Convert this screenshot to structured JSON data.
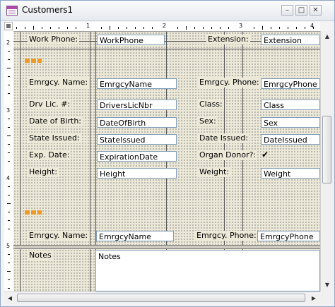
{
  "window": {
    "title": "Customers1",
    "controls": {
      "minimize": "–",
      "maximize": "□",
      "close": "✕"
    }
  },
  "icons": {
    "app": "form-icon",
    "scroll_up": "arrow-up-icon",
    "scroll_down": "arrow-down-icon",
    "scroll_left": "arrow-left-icon",
    "scroll_right": "arrow-right-icon"
  },
  "ruler": {
    "horizontal": [
      "1",
      "2",
      "3",
      "4"
    ],
    "vertical": [
      "2",
      "3",
      "4",
      "5"
    ]
  },
  "form": {
    "work_phone_label": "Work Phone:",
    "work_phone_field": "WorkPhone",
    "extension_label": "Extension:",
    "extension_field": "Extension",
    "emrgcy_name_label": "Emrgcy. Name:",
    "emrgcy_name_field": "EmrgcyName",
    "emrgcy_phone_label": "Emrgcy. Phone:",
    "emrgcy_phone_field": "EmrgcyPhone",
    "drv_lic_label": "Drv Lic. #:",
    "drv_lic_field": "DriversLicNbr",
    "class_label": "Class:",
    "class_field": "Class",
    "dob_label": "Date of Birth:",
    "dob_field": "DateOfBirth",
    "sex_label": "Sex:",
    "sex_field": "Sex",
    "state_issued_label": "State Issued:",
    "state_issued_field": "StateIssued",
    "date_issued_label": "Date Issued:",
    "date_issued_field": "DateIssued",
    "exp_date_label": "Exp. Date:",
    "exp_date_field": "ExpirationDate",
    "organ_donor_label": "Organ Donor?:",
    "organ_donor_checked": true,
    "organ_donor_mark": "✔",
    "height_label": "Height:",
    "height_field": "Height",
    "weight_label": "Weight:",
    "weight_field": "Weight",
    "emrgcy_name2_label": "Emrgcy. Name:",
    "emrgcy_name2_field": "EmrgcyName",
    "emrgcy_phone2_label": "Emrgcy. Phone:",
    "emrgcy_phone2_field": "EmrgcyPhone",
    "notes_label": "Notes",
    "notes_field": "Notes"
  },
  "colors": {
    "grid_background": "#ece9d8",
    "marker": "#ee9a2a",
    "field_border": "#7f9db9"
  }
}
